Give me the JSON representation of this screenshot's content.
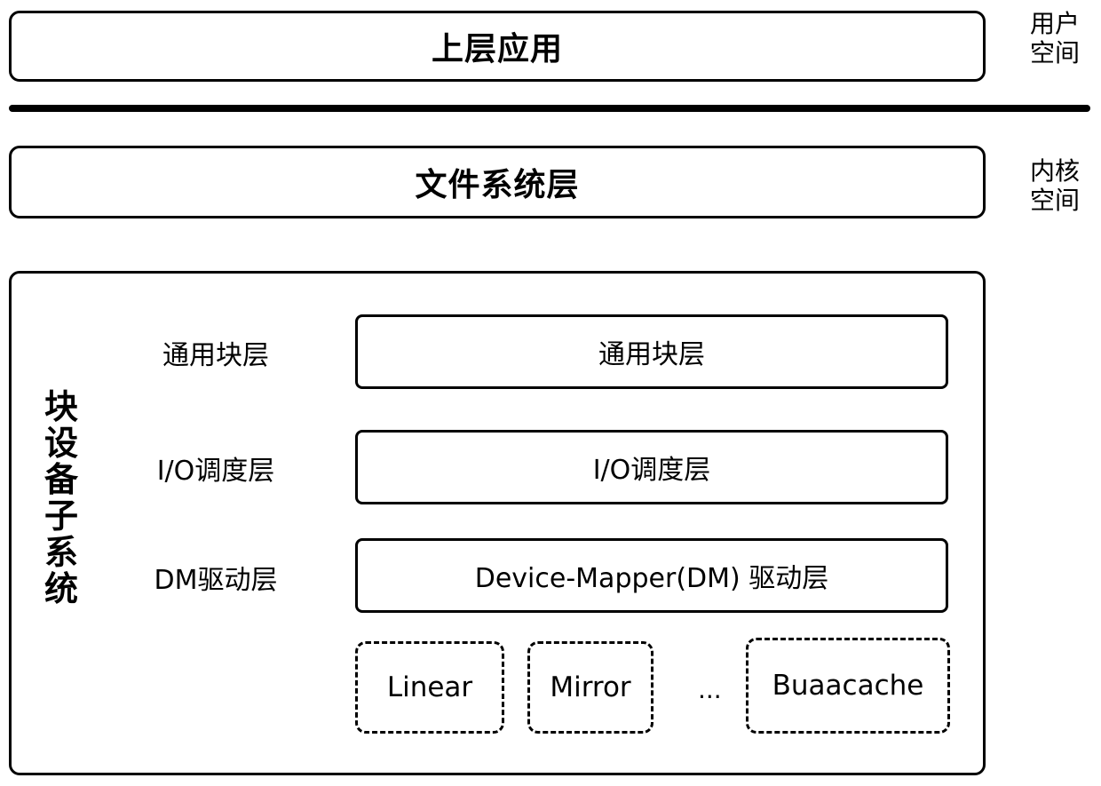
{
  "diagram": {
    "user_space": {
      "box_label": "上层应用",
      "side_label_line1": "用户",
      "side_label_line2": "空间"
    },
    "kernel_space": {
      "box_label": "文件系统层",
      "side_label_line1": "内核",
      "side_label_line2": "空间"
    },
    "block_subsystem": {
      "title": "块设备子系统",
      "rows": [
        {
          "label": "通用块层",
          "box": "通用块层"
        },
        {
          "label": "I/O调度层",
          "box": "I/O调度层"
        },
        {
          "label": "DM驱动层",
          "box": "Device-Mapper(DM) 驱动层"
        }
      ],
      "targets": [
        "Linear",
        "Mirror",
        "Buaacache"
      ],
      "ellipsis": "..."
    }
  }
}
